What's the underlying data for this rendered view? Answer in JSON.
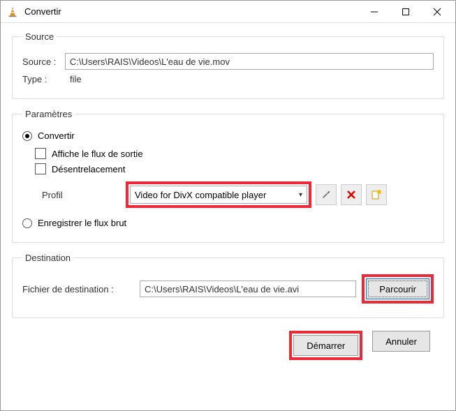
{
  "window": {
    "title": "Convertir"
  },
  "source": {
    "legend": "Source",
    "source_label": "Source :",
    "source_value": "C:\\Users\\RAIS\\Videos\\L'eau de vie.mov",
    "type_label": "Type :",
    "type_value": "file"
  },
  "params": {
    "legend": "Paramètres",
    "convert_label": "Convertir",
    "show_output_label": "Affiche le flux de sortie",
    "deinterlace_label": "Désentrelacement",
    "profile_label": "Profil",
    "profile_value": "Video for DivX compatible player",
    "dump_raw_label": "Enregistrer le flux brut"
  },
  "destination": {
    "legend": "Destination",
    "file_label": "Fichier de destination :",
    "file_value": "C:\\Users\\RAIS\\Videos\\L'eau de vie.avi",
    "browse_label": "Parcourir"
  },
  "footer": {
    "start_label": "Démarrer",
    "cancel_label": "Annuler"
  }
}
